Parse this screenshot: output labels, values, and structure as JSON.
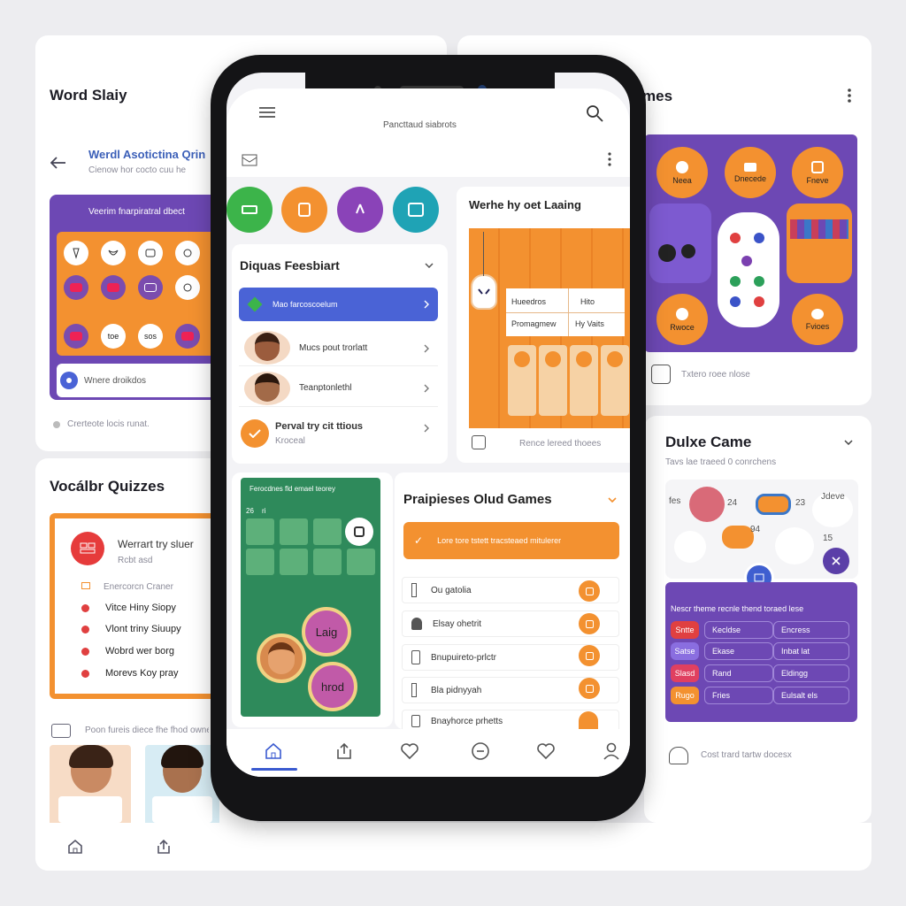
{
  "app": {
    "word_slay_title": "Word Slaiy",
    "games_title_partial": "mes",
    "vocab_title": "Vocálbr Quizzes",
    "deluxe_title": "Dulxe Came"
  },
  "left_top": {
    "back_title": "Werdl Asotictina Qrin",
    "back_sub": "Cienow hor cocto cuu he",
    "grid_heading": "Veerim fnarpiratral dbect",
    "grid_cells": [
      "",
      "",
      "",
      "",
      "",
      "",
      "",
      "",
      "toe",
      "sos",
      "",
      ""
    ],
    "info_text": "Wnere droikdos",
    "footer_text": "Crerteote locis runat."
  },
  "vocab": {
    "quiz_name": "Werrart try sluer",
    "quiz_sub": "Rcbt asd",
    "section": "Enercorcn Craner",
    "items": [
      "Vitce Hiny Siopy",
      "Vlont triny Siuupy",
      "Wobrd wer borg",
      "Morevs Koy pray"
    ],
    "footer_text": "Poon fureis diece fhe fhod owned"
  },
  "right_top": {
    "tiles": [
      "Neea",
      "Dnecede",
      "Fneve",
      "",
      "",
      "",
      "Rwoce",
      "",
      "Fvioes"
    ],
    "footer_text": "Txtero roee nlose"
  },
  "deluxe": {
    "subtitle": "Tavs lae traeed 0 conrchens",
    "labels": [
      "fes",
      "24",
      "23",
      "Jdeve",
      "94",
      "15"
    ],
    "panel_heading": "Nescr theme recnle thend toraed lese",
    "rows": [
      [
        "Sntte",
        "Kecldse",
        "Encress"
      ],
      [
        "Satse",
        "Ekase",
        "Inbat lat"
      ],
      [
        "Slasd",
        "Rand",
        "Eldingg"
      ],
      [
        "Rugo",
        "Fries",
        "Eulsalt els"
      ]
    ],
    "footer_text": "Cost trard tartw docesx"
  },
  "phone": {
    "header_title": "Pancttaud siabrots",
    "discuss_title": "Diquas Feesbiart",
    "list": [
      {
        "label": "Mao farcoscoelum",
        "highlight": true
      },
      {
        "label": "Mucs pout trorlatt",
        "highlight": false
      },
      {
        "label": "Teanptonlethl",
        "highlight": false
      },
      {
        "label": "Perval try cit ttious",
        "sub": "Kroceal",
        "highlight": false
      }
    ],
    "learning_title": "Werhe hy oet Laaing",
    "table": [
      [
        "Hueedros",
        "Hito"
      ],
      [
        "Promagmew",
        "Hy Vaits"
      ]
    ],
    "learning_footer": "Rence lereed thoees",
    "green_card_title": "Ferocdnes fld emael teorey",
    "green_card_nums": [
      "26",
      "ri"
    ],
    "bubble_a": "Laig",
    "bubble_b": "hrod",
    "popular_title": "Praipieses Olud Games",
    "popular_banner": "Lore tore tstett tracsteaed mitulerer",
    "games": [
      "Ou gatolia",
      "Elsay ohetrit",
      "Bnupuireto-prlctr",
      "Bla pidnyyah",
      "Bnayhorce prhetts"
    ]
  },
  "bottom_bar": {
    "icons": [
      "home-icon",
      "share-icon"
    ]
  },
  "colors": {
    "orange": "#f39130",
    "purple": "#6d48b4",
    "green": "#2e8a5b",
    "blue": "#4a63d6",
    "red": "#e04040"
  }
}
